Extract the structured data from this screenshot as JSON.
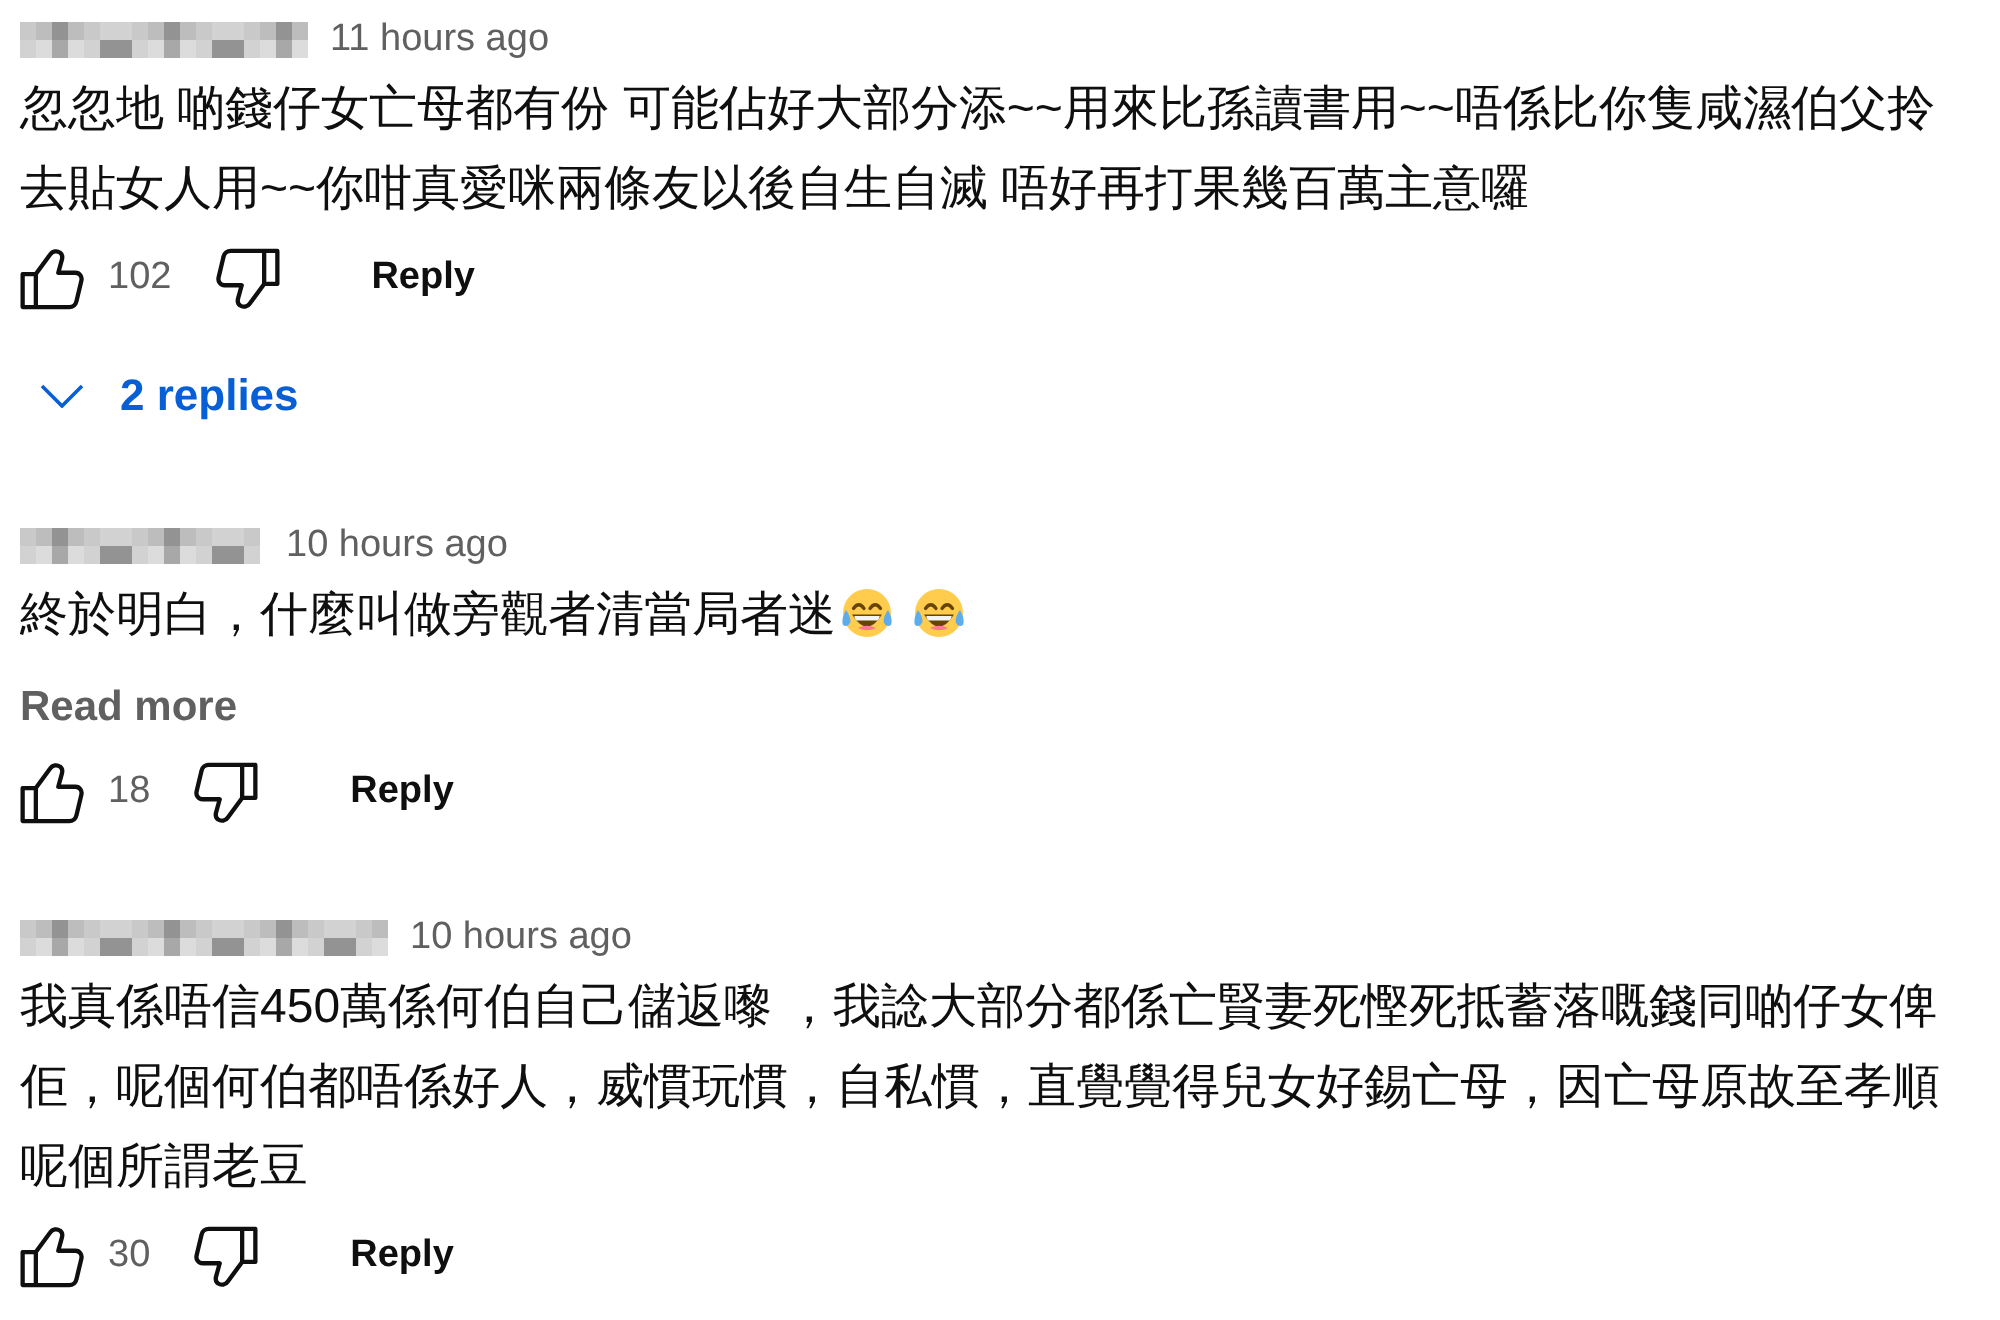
{
  "comments": [
    {
      "timestamp": "11 hours ago",
      "text": "忽忽地 啲錢仔女亡母都有份 可能佔好大部分添~~用來比孫讀書用~~唔係比你隻咸濕伯父拎去貼女人用~~你咁真愛咪兩條友以後自生自滅 唔好再打果幾百萬主意囉",
      "likes": "102",
      "reply_label": "Reply",
      "replies_toggle": "2 replies"
    },
    {
      "timestamp": "10 hours ago",
      "text": "終於明白，什麼叫做旁觀者清當局者迷",
      "emojis": [
        {
          "kind": "tears-of-joy"
        },
        {
          "kind": "tears-of-joy"
        }
      ],
      "read_more": "Read more",
      "likes": "18",
      "reply_label": "Reply"
    },
    {
      "timestamp": "10 hours ago",
      "text": "我真係唔信450萬係何伯自己儲返嚟 ，我諗大部分都係亡賢妻死慳死抵蓄落嘅錢同啲仔女俾佢，呢個何伯都唔係好人，威慣玩慣，自私慣，直覺覺得兒女好錫亡母，因亡母原故至孝順呢個所謂老豆",
      "likes": "30",
      "reply_label": "Reply"
    }
  ]
}
